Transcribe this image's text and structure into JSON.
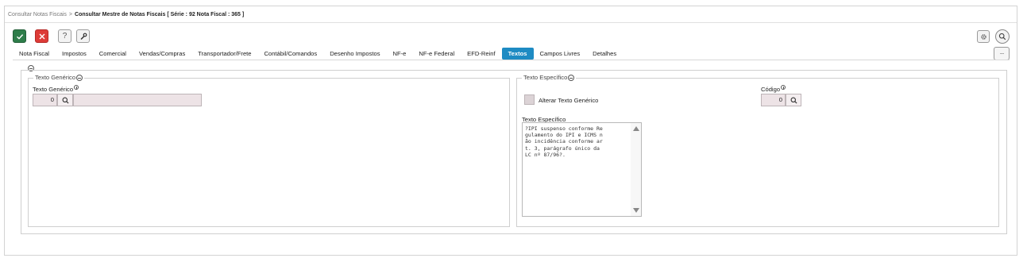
{
  "breadcrumb": {
    "parent": "Consultar Notas Fiscais",
    "separator": ">",
    "current": "Consultar Mestre de Notas Fiscais [ Série : 92 Nota Fiscal : 365 ]"
  },
  "toolbar": {
    "confirm_icon": "check-icon",
    "cancel_icon": "close-icon",
    "help_label": "?",
    "tools_icon": "wrench-icon",
    "settings_icon": "gear-icon",
    "zoom_icon": "magnifier-icon",
    "more_label": "···"
  },
  "tabs": [
    {
      "label": "Nota Fiscal",
      "active": false
    },
    {
      "label": "Impostos",
      "active": false
    },
    {
      "label": "Comercial",
      "active": false
    },
    {
      "label": "Vendas/Compras",
      "active": false
    },
    {
      "label": "Transportador/Frete",
      "active": false
    },
    {
      "label": "Contábil/Comandos",
      "active": false
    },
    {
      "label": "Desenho Impostos",
      "active": false
    },
    {
      "label": "NF-e",
      "active": false
    },
    {
      "label": "NF-e Federal",
      "active": false
    },
    {
      "label": "EFD-Reinf",
      "active": false
    },
    {
      "label": "Textos",
      "active": true
    },
    {
      "label": "Campos Livres",
      "active": false
    },
    {
      "label": "Detalhes",
      "active": false
    }
  ],
  "generic": {
    "legend": "Texto Genérico",
    "field_label": "Texto Genérico",
    "code_value": "0",
    "description_value": ""
  },
  "specific": {
    "legend": "Texto Específico",
    "checkbox_label": "Alterar Texto Genérico",
    "code_label": "Código",
    "code_value": "0",
    "text_label": "Texto Específico",
    "text_value": "?IPI suspenso conforme Re\ngulamento do IPI e ICMS n\não incidência conforme ar\nt. 3, parágrafo único da\nLC nº 87/96?."
  },
  "colors": {
    "active_tab": "#1e8bc3",
    "confirm": "#2e7d4a",
    "cancel": "#dd3b37",
    "readonly_field": "#ede3e6"
  }
}
